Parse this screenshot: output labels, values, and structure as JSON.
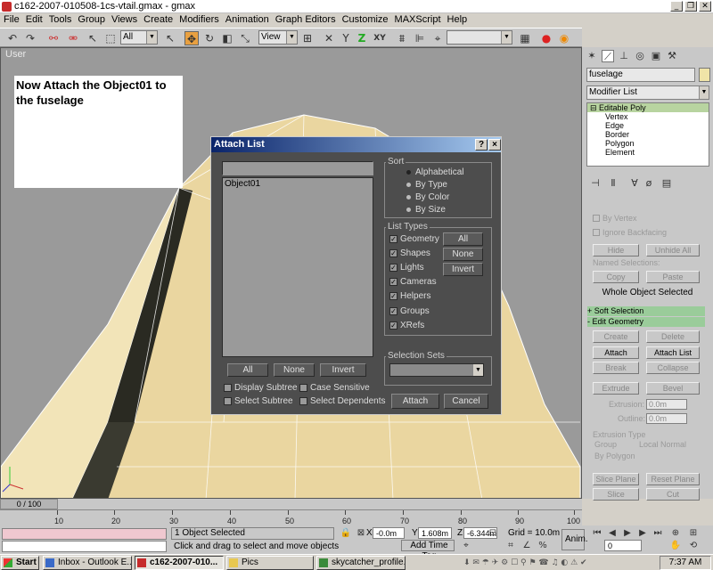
{
  "window": {
    "title": "c162-2007-010508-1cs-vtail.gmax - gmax",
    "minimize": "_",
    "restore": "❐",
    "close": "✕"
  },
  "menu": [
    "File",
    "Edit",
    "Tools",
    "Group",
    "Views",
    "Create",
    "Modifiers",
    "Animation",
    "Graph Editors",
    "Customize",
    "MAXScript",
    "Help"
  ],
  "toolbar": {
    "selection_filter": "All",
    "reference_coord": "View",
    "snap_label": "XY",
    "icons": [
      "undo-icon",
      "redo-icon",
      "link-icon",
      "unlink-icon",
      "select-arrow-icon",
      "select-region-icon",
      "move-icon",
      "rotate-icon",
      "scale-icon",
      "mirror-icon",
      "align-icon",
      "material-editor-icon",
      "render-icon"
    ]
  },
  "viewport": {
    "label": "User",
    "note": "Now Attach the Object01 to the fuselage"
  },
  "dialog": {
    "title": "Attach List",
    "help_btn": "?",
    "close_btn": "×",
    "search_value": "",
    "list_items": [
      "Object01"
    ],
    "sort_label": "Sort",
    "sort_options": [
      "Alphabetical",
      "By Type",
      "By Color",
      "By Size"
    ],
    "sort_selected": "Alphabetical",
    "list_types_label": "List Types",
    "list_types": [
      "Geometry",
      "Shapes",
      "Lights",
      "Cameras",
      "Helpers",
      "Groups",
      "XRefs"
    ],
    "type_buttons": [
      "All",
      "None",
      "Invert"
    ],
    "bottom_buttons": [
      "All",
      "None",
      "Invert"
    ],
    "checkboxes": [
      "Display Subtree",
      "Case Sensitive",
      "Select Subtree",
      "Select Dependents"
    ],
    "selection_sets_label": "Selection Sets",
    "selection_sets_value": "",
    "attach_btn": "Attach",
    "cancel_btn": "Cancel"
  },
  "command_panel": {
    "object_name": "fuselage",
    "modifier_list": "Modifier List",
    "stack": {
      "root": "Editable Poly",
      "sub": [
        "Vertex",
        "Edge",
        "Border",
        "Polygon",
        "Element"
      ]
    },
    "selection": {
      "by_vertex": "By Vertex",
      "ignore_backfacing": "Ignore Backfacing",
      "hide": "Hide",
      "unhide_all": "Unhide All",
      "named_selections": "Named Selections:",
      "copy": "Copy",
      "paste": "Paste",
      "whole_object": "Whole Object Selected"
    },
    "soft_selection": "+          Soft Selection",
    "edit_geometry": "-          Edit Geometry",
    "geometry": {
      "create": "Create",
      "delete": "Delete",
      "attach": "Attach",
      "attach_list": "Attach List",
      "break": "Break",
      "collapse": "Collapse",
      "extrude": "Extrude",
      "bevel": "Bevel",
      "extrusion_label": "Extrusion:",
      "extrusion_value": "0.0m",
      "outline_label": "Outline:",
      "outline_value": "0.0m",
      "extrusion_type": "Extrusion Type",
      "group": "Group",
      "local_normal": "Local Normal",
      "by_polygon": "By Polygon",
      "slice_plane": "Slice Plane",
      "reset_plane": "Reset Plane",
      "slice": "Slice",
      "cut": "Cut",
      "split": "Split"
    }
  },
  "timeline": {
    "frame": "0 / 100",
    "ticks": [
      "10",
      "20",
      "30",
      "40",
      "50",
      "60",
      "70",
      "80",
      "90",
      "100"
    ]
  },
  "status": {
    "selected": "1 Object Selected",
    "prompt": "Click and drag to select and move objects",
    "x_label": "X",
    "x": "-0.0m",
    "y_label": "Y",
    "y": "1.608m",
    "z_label": "Z",
    "z": "-6.344m",
    "grid": "Grid = 10.0m",
    "add_time_tag": "Add Time Tag",
    "anim": "Anim.",
    "frame_field": "0"
  },
  "taskbar": {
    "start": "Start",
    "tasks": [
      "Inbox - Outlook E...",
      "c162-2007-010...",
      "Pics",
      "skycatcher_profile...."
    ],
    "active_index": 1,
    "clock": "7:37 AM"
  },
  "colors": {
    "fuselage_light": "#ead6a0",
    "fuselage_dark": "#2a2a22",
    "viewport_bg": "#9a9a9a",
    "dialog_bg": "#4d4d4d",
    "rollout_green": "#9acc9a",
    "title_gradient_start": "#0a246a"
  }
}
